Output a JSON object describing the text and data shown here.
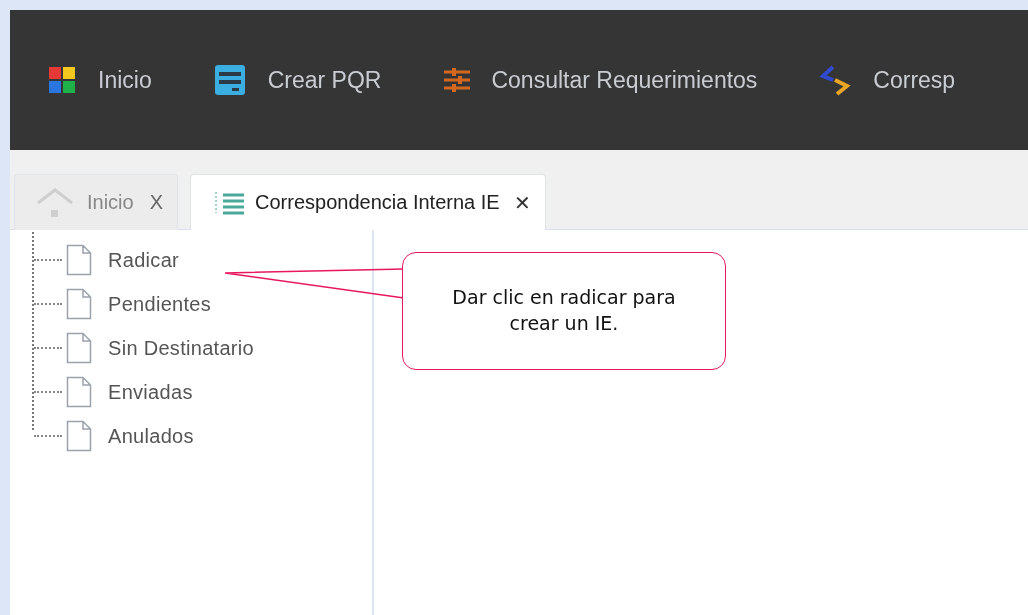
{
  "menu": [
    {
      "label": "Inicio"
    },
    {
      "label": "Crear PQR"
    },
    {
      "label": "Consultar Requerimientos"
    },
    {
      "label": "Corresp"
    }
  ],
  "tabs": [
    {
      "label": "Inicio",
      "close": "X",
      "selected": false
    },
    {
      "label": "Correspondencia Interna IE",
      "close": "✕",
      "selected": true
    }
  ],
  "tree": {
    "items": [
      {
        "label": "Radicar"
      },
      {
        "label": "Pendientes"
      },
      {
        "label": "Sin Destinatario"
      },
      {
        "label": "Enviadas"
      },
      {
        "label": "Anulados"
      }
    ]
  },
  "callout": {
    "text": "Dar clic en radicar para crear un IE."
  }
}
